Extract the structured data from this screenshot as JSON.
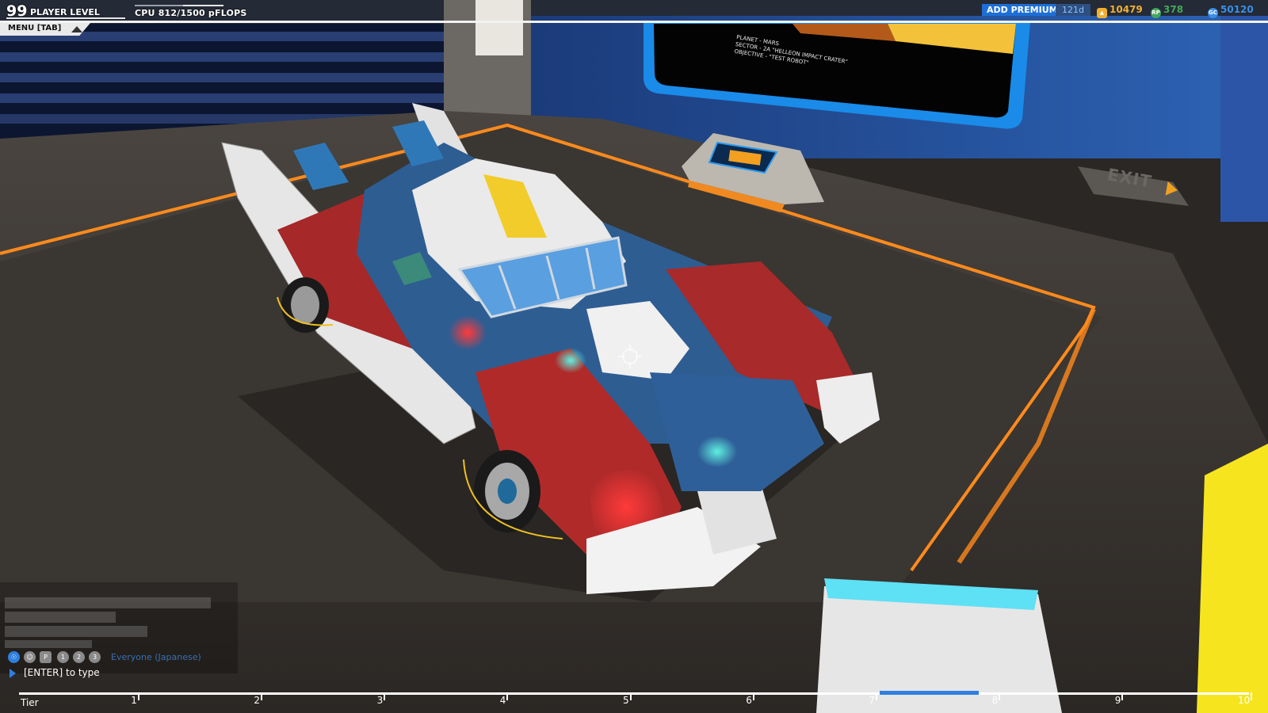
{
  "hud": {
    "player_level_value": "99",
    "player_level_label": "PLAYER LEVEL",
    "cpu_label": "CPU",
    "cpu_value": "812/1500 pFLOPS",
    "cpu_fraction": 0.541,
    "menu_label": "MENU [TAB]",
    "premium_label": "ADD PREMIUM:",
    "premium_days": "121d",
    "currencies": [
      {
        "name": "tech-points",
        "value": "10479",
        "color": "#f0b030",
        "icon": "trophy-icon"
      },
      {
        "name": "robits",
        "value": "378",
        "color": "#43a85a",
        "icon": "rp-icon"
      },
      {
        "name": "galaxy-coins",
        "value": "50120",
        "color": "#3a8fe6",
        "icon": "gc-icon"
      }
    ]
  },
  "screen": {
    "line1": "PLANET - MARS",
    "line2": "SECTOR - 2A \"HELLEON IMPACT CRATER\"",
    "line3": "OBJECTIVE - \"TEST ROBOT\""
  },
  "exit_label": "EXIT",
  "chat": {
    "channel": "Everyone (Japanese)",
    "prompt": "[ENTER] to type",
    "icons": [
      "globe-icon",
      "accessibility-icon",
      "p-icon",
      "party-1-icon",
      "party-2-icon",
      "party-3-icon"
    ]
  },
  "tier": {
    "label": "Tier",
    "ticks": [
      "1",
      "2",
      "3",
      "4",
      "5",
      "6",
      "7",
      "8",
      "9",
      "10"
    ],
    "current_tier": 8
  },
  "colors": {
    "accent_blue": "#2f7fe0",
    "floor_orange": "#ff8a1c",
    "robot_red": "#b52a2a",
    "robot_blue": "#2e5d92",
    "robot_white": "#e8e8e8"
  }
}
